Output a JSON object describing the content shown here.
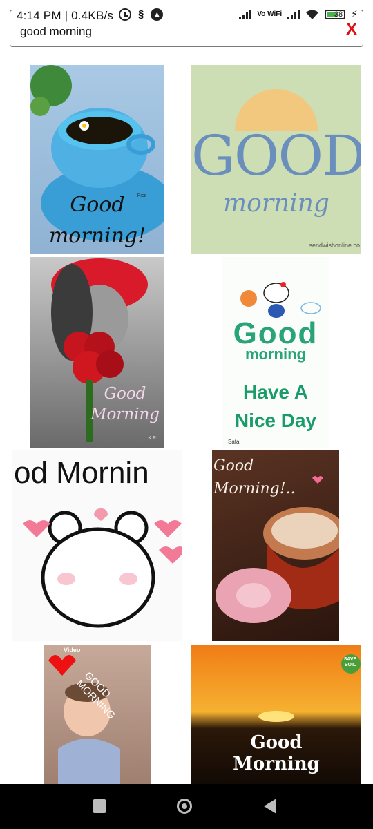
{
  "status_bar": {
    "time": "4:14 PM | 0.4KB/s",
    "vowifi": "Vo WiFi",
    "battery": "38"
  },
  "search": {
    "query": "good morning",
    "close": "X"
  },
  "results": [
    {
      "caption": "Good morning!",
      "badge": "Pics"
    },
    {
      "caption_top": "GOOD",
      "caption_bottom": "morning",
      "footer": "sendwishonline.co"
    },
    {
      "caption": "Good Morning",
      "corner": "K.R."
    },
    {
      "caption_top": "Good",
      "caption_mid": "morning",
      "caption_bottom": "Have A Nice Day",
      "footer": "Safa"
    },
    {
      "caption": "od Mornin"
    },
    {
      "caption": "Good Morning!.."
    },
    {
      "caption": "GOOD MORNING",
      "badge": "Video"
    },
    {
      "caption": "Good Morning",
      "badge": "SAVE SOIL"
    }
  ]
}
